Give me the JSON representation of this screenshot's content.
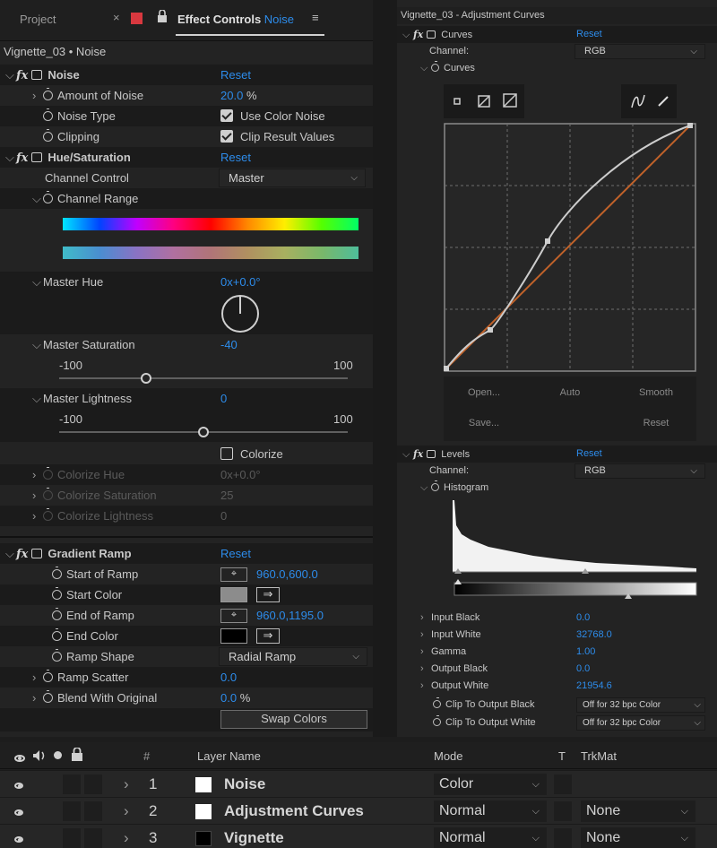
{
  "left": {
    "tabs": {
      "project": "Project",
      "close": "×",
      "effect_controls": "Effect Controls",
      "effect_controls_layer": "Noise",
      "menu": "≡"
    },
    "layer_title": "Vignette_03 • Noise",
    "noise": {
      "name": "Noise",
      "reset": "Reset",
      "amount_label": "Amount of Noise",
      "amount_value": "20.0",
      "amount_unit": "%",
      "type_label": "Noise Type",
      "type_value": "Use Color Noise",
      "clip_label": "Clipping",
      "clip_value": "Clip Result Values"
    },
    "hue_sat": {
      "name": "Hue/Saturation",
      "reset": "Reset",
      "channel_control_label": "Channel Control",
      "channel_control_value": "Master",
      "channel_range_label": "Channel Range",
      "master_hue_label": "Master Hue",
      "master_hue_value": "0x+0.0°",
      "master_sat_label": "Master Saturation",
      "master_sat_value": "-40",
      "sat_min": "-100",
      "sat_max": "100",
      "sat_level": 0.3,
      "master_light_label": "Master Lightness",
      "master_light_value": "0",
      "light_min": "-100",
      "light_max": "100",
      "light_level": 0.5,
      "colorize_label": "Colorize",
      "colorize_hue_label": "Colorize Hue",
      "colorize_hue_value": "0x+0.0°",
      "colorize_sat_label": "Colorize Saturation",
      "colorize_sat_value": "25",
      "colorize_light_label": "Colorize Lightness",
      "colorize_light_value": "0"
    },
    "gradient": {
      "name": "Gradient Ramp",
      "reset": "Reset",
      "start_label": "Start of Ramp",
      "start_value": "960.0,600.0",
      "start_color_label": "Start Color",
      "start_color": "#8c8c8c",
      "end_label": "End of Ramp",
      "end_value": "960.0,1195.0",
      "end_color_label": "End Color",
      "end_color": "#000000",
      "shape_label": "Ramp Shape",
      "shape_value": "Radial Ramp",
      "scatter_label": "Ramp Scatter",
      "scatter_value": "0.0",
      "blend_label": "Blend With Original",
      "blend_value": "0.0",
      "blend_unit": "%",
      "swap_label": "Swap Colors"
    }
  },
  "right": {
    "title": "Vignette_03 - Adjustment Curves",
    "curves": {
      "name": "Curves",
      "reset": "Reset",
      "channel_label": "Channel:",
      "channel_value": "RGB",
      "sub_label": "Curves",
      "open": "Open...",
      "auto": "Auto",
      "smooth": "Smooth",
      "save": "Save...",
      "reset_btn": "Reset"
    },
    "levels": {
      "name": "Levels",
      "reset": "Reset",
      "channel_label": "Channel:",
      "channel_value": "RGB",
      "histogram_label": "Histogram",
      "params": [
        {
          "label": "Input Black",
          "value": "0.0"
        },
        {
          "label": "Input White",
          "value": "32768.0"
        },
        {
          "label": "Gamma",
          "value": "1.00"
        },
        {
          "label": "Output Black",
          "value": "0.0"
        },
        {
          "label": "Output White",
          "value": "21954.6"
        }
      ],
      "clip_black_label": "Clip To Output Black",
      "clip_black_value": "Off for 32 bpc Color",
      "clip_white_label": "Clip To Output White",
      "clip_white_value": "Off for 32 bpc Color"
    }
  },
  "timeline": {
    "headers": {
      "num": "#",
      "layer_name": "Layer Name",
      "mode": "Mode",
      "t": "T",
      "trkmat": "TrkMat"
    },
    "layers": [
      {
        "num": "1",
        "name": "Noise",
        "mode": "Color",
        "trkmat": "",
        "swatch": "#ffffff"
      },
      {
        "num": "2",
        "name": "Adjustment Curves",
        "mode": "Normal",
        "trkmat": "None",
        "swatch": "#ffffff"
      },
      {
        "num": "3",
        "name": "Vignette",
        "mode": "Normal",
        "trkmat": "None",
        "swatch": "#000000"
      }
    ]
  }
}
